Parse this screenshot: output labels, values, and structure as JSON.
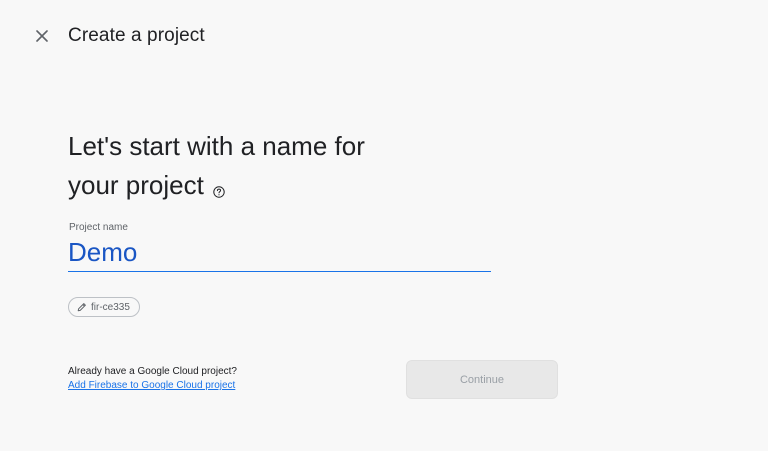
{
  "header": {
    "close_icon": "close-icon",
    "title": "Create a project"
  },
  "main": {
    "headline_line1": "Let's start with a name for",
    "headline_line2": "your project",
    "help_icon": "help-circle-icon",
    "project_name": {
      "label": "Project name",
      "value": "Demo"
    },
    "project_id_chip": {
      "icon": "pencil-icon",
      "value": "fir-ce335"
    }
  },
  "footer": {
    "cloud_question": "Already have a Google Cloud project?",
    "cloud_link": "Add Firebase to Google Cloud project",
    "continue_label": "Continue"
  },
  "colors": {
    "background": "#f8f8f8",
    "accent": "#1a73e8",
    "input_text": "#1a56c4",
    "disabled_button": "#e8e8e8"
  }
}
